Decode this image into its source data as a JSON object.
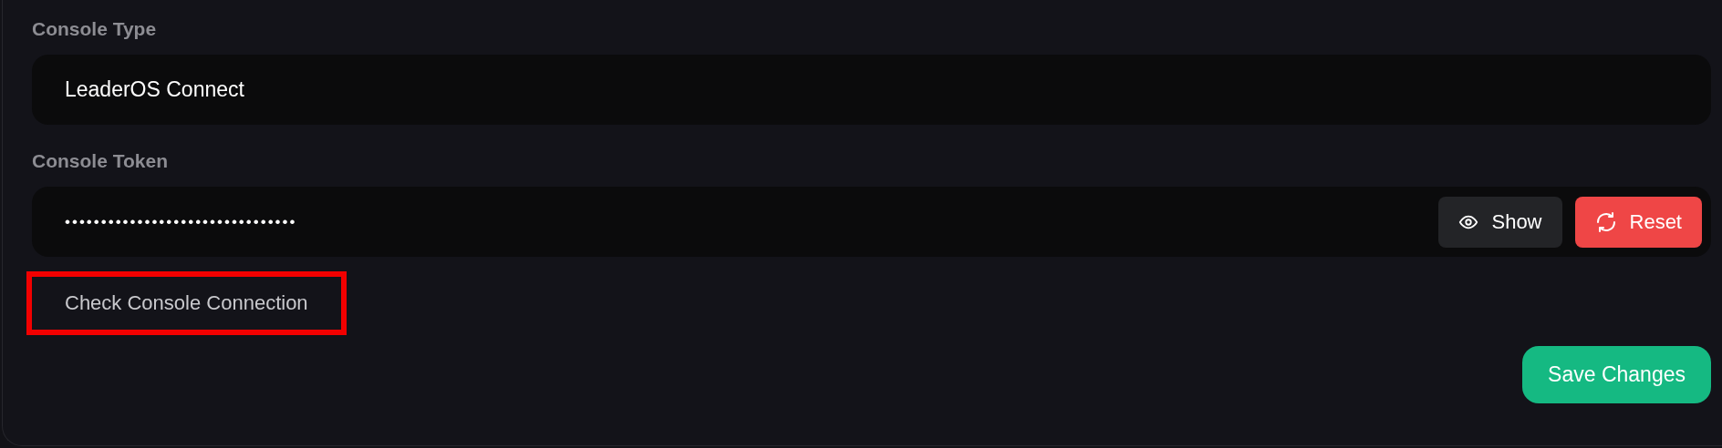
{
  "fields": [
    {
      "label": "Console Type",
      "value": "LeaderOS Connect",
      "kind": "text"
    },
    {
      "label": "Console Token",
      "value": "••••••••••••••••••••••••••••••••",
      "kind": "secret",
      "buttons": [
        {
          "label": "Show",
          "kind": "show"
        },
        {
          "label": "Reset",
          "kind": "reset"
        }
      ]
    }
  ],
  "check_button": {
    "label": "Check Console Connection",
    "highlighted": true
  },
  "save_button": {
    "label": "Save Changes"
  }
}
